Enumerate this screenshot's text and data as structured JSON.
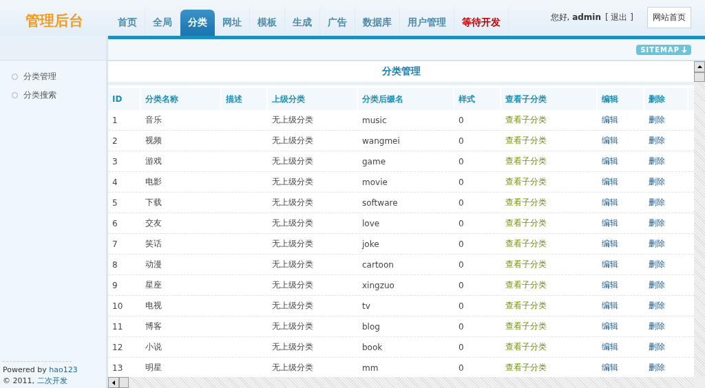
{
  "logo": "管理后台",
  "tabs": [
    {
      "label": "首页",
      "selected": false,
      "kind": "normal"
    },
    {
      "label": "全局",
      "selected": false,
      "kind": "normal"
    },
    {
      "label": "分类",
      "selected": true,
      "kind": "normal"
    },
    {
      "label": "网址",
      "selected": false,
      "kind": "normal"
    },
    {
      "label": "模板",
      "selected": false,
      "kind": "normal"
    },
    {
      "label": "生成",
      "selected": false,
      "kind": "normal"
    },
    {
      "label": "广告",
      "selected": false,
      "kind": "normal"
    },
    {
      "label": "数据库",
      "selected": false,
      "kind": "normal"
    },
    {
      "label": "用户管理",
      "selected": false,
      "kind": "normal"
    },
    {
      "label": "等待开发",
      "selected": false,
      "kind": "alert"
    }
  ],
  "user_bar": {
    "greeting": "您好, **admin**",
    "logout": "[ 退出 ]",
    "home_button": "网站首页"
  },
  "sitemap_button": "SITEMAP",
  "sidebar": {
    "items": [
      {
        "label": "分类管理"
      },
      {
        "label": "分类搜索"
      }
    ],
    "footer": {
      "powered_by": "Powered by",
      "powered_link": "hao123",
      "copyright": "© 2011,",
      "copyright_link": "二次开发"
    }
  },
  "panel": {
    "title": "分类管理",
    "table": {
      "columns": [
        "ID",
        "分类名称",
        "描述",
        "上级分类",
        "分类后缀名",
        "样式",
        "查看子分类",
        "编辑",
        "删除"
      ],
      "rows": [
        {
          "id": "1",
          "name": "音乐",
          "parent": "无上级分类",
          "suffix": "music",
          "style": "0",
          "view": "查看子分类",
          "edit": "编辑",
          "delete": "删除"
        },
        {
          "id": "2",
          "name": "视频",
          "parent": "无上级分类",
          "suffix": "wangmei",
          "style": "0",
          "view": "查看子分类",
          "edit": "编辑",
          "delete": "删除"
        },
        {
          "id": "3",
          "name": "游戏",
          "parent": "无上级分类",
          "suffix": "game",
          "style": "0",
          "view": "查看子分类",
          "edit": "编辑",
          "delete": "删除"
        },
        {
          "id": "4",
          "name": "电影",
          "parent": "无上级分类",
          "suffix": "movie",
          "style": "0",
          "view": "查看子分类",
          "edit": "编辑",
          "delete": "删除"
        },
        {
          "id": "5",
          "name": "下载",
          "parent": "无上级分类",
          "suffix": "software",
          "style": "0",
          "view": "查看子分类",
          "edit": "编辑",
          "delete": "删除"
        },
        {
          "id": "6",
          "name": "交友",
          "parent": "无上级分类",
          "suffix": "love",
          "style": "0",
          "view": "查看子分类",
          "edit": "编辑",
          "delete": "删除"
        },
        {
          "id": "7",
          "name": "笑话",
          "parent": "无上级分类",
          "suffix": "joke",
          "style": "0",
          "view": "查看子分类",
          "edit": "编辑",
          "delete": "删除"
        },
        {
          "id": "8",
          "name": "动漫",
          "parent": "无上级分类",
          "suffix": "cartoon",
          "style": "0",
          "view": "查看子分类",
          "edit": "编辑",
          "delete": "删除"
        },
        {
          "id": "9",
          "name": "星座",
          "parent": "无上级分类",
          "suffix": "xingzuo",
          "style": "0",
          "view": "查看子分类",
          "edit": "编辑",
          "delete": "删除"
        },
        {
          "id": "10",
          "name": "电视",
          "parent": "无上级分类",
          "suffix": "tv",
          "style": "0",
          "view": "查看子分类",
          "edit": "编辑",
          "delete": "删除"
        },
        {
          "id": "11",
          "name": "博客",
          "parent": "无上级分类",
          "suffix": "blog",
          "style": "0",
          "view": "查看子分类",
          "edit": "编辑",
          "delete": "删除"
        },
        {
          "id": "12",
          "name": "小说",
          "parent": "无上级分类",
          "suffix": "book",
          "style": "0",
          "view": "查看子分类",
          "edit": "编辑",
          "delete": "删除"
        },
        {
          "id": "13",
          "name": "明星",
          "parent": "无上级分类",
          "suffix": "mm",
          "style": "0",
          "view": "查看子分类",
          "edit": "编辑",
          "delete": "删除"
        }
      ]
    }
  }
}
